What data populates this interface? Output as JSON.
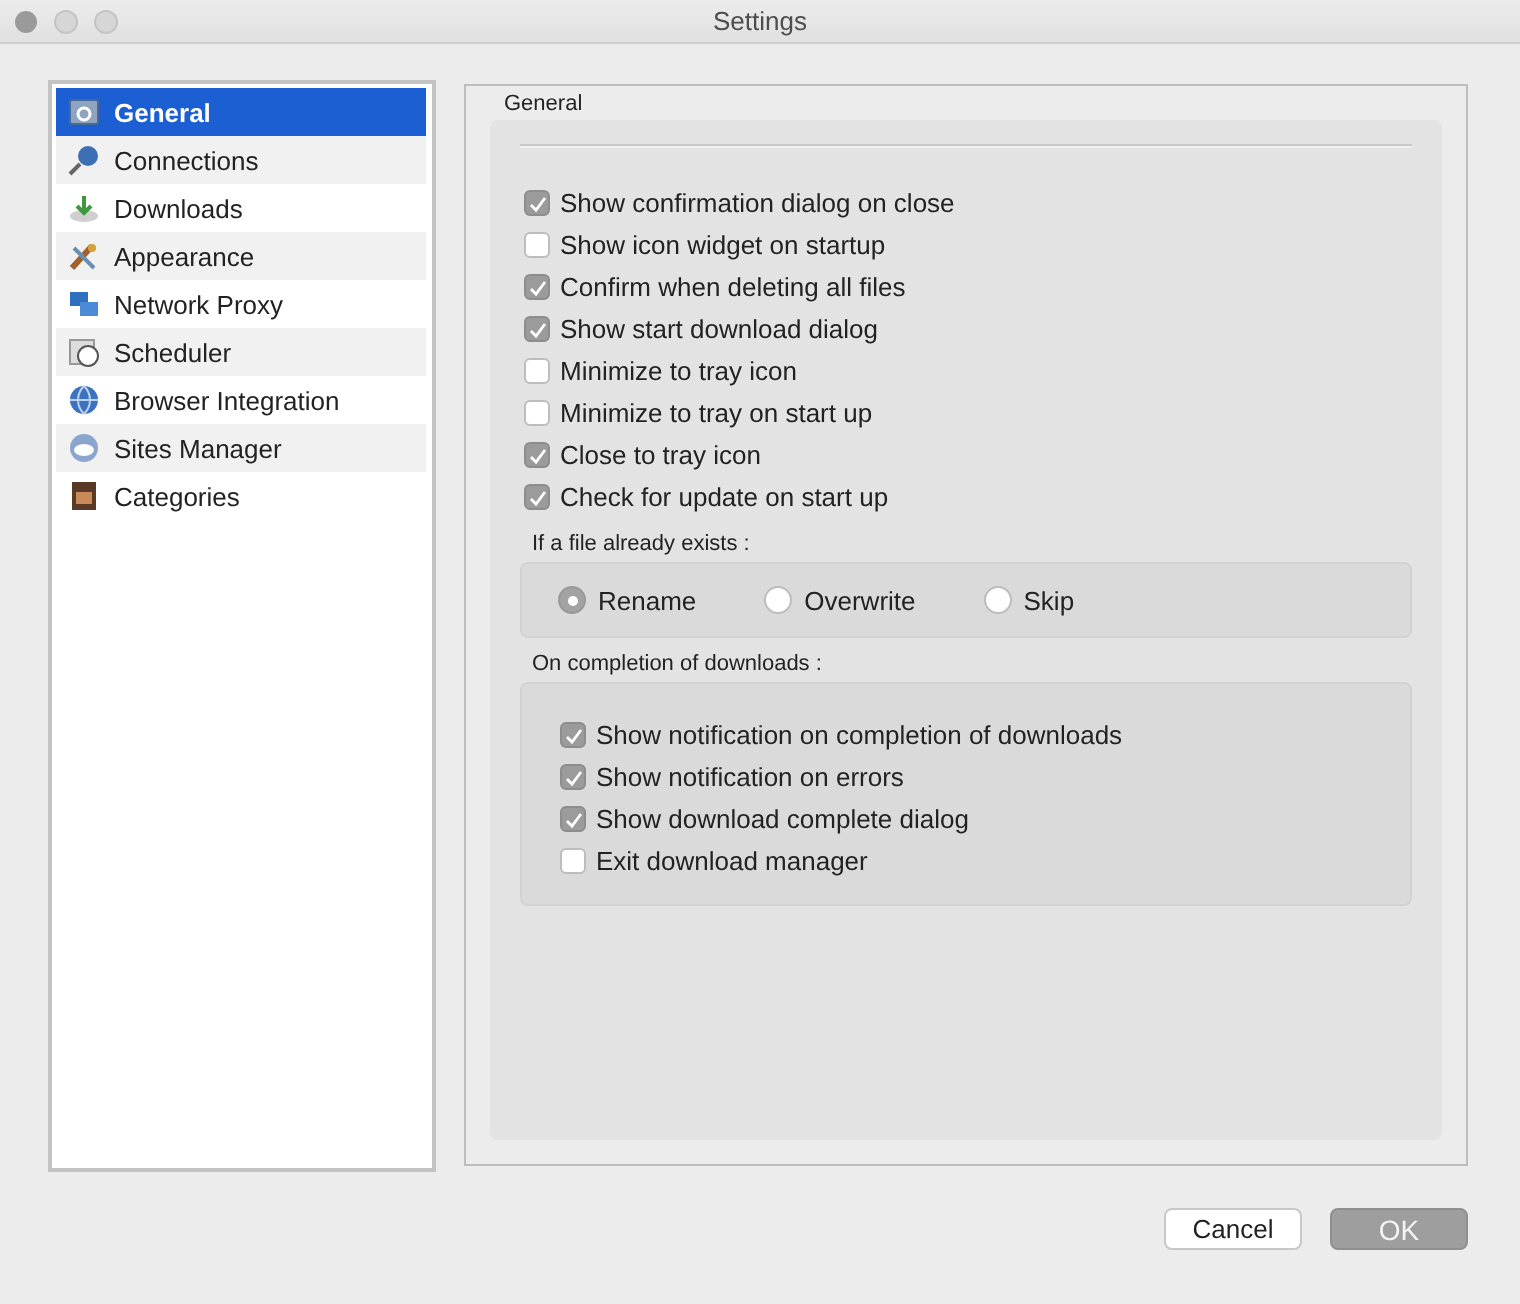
{
  "window": {
    "title": "Settings"
  },
  "sidebar": {
    "items": [
      {
        "label": "General",
        "selected": true
      },
      {
        "label": "Connections",
        "selected": false
      },
      {
        "label": "Downloads",
        "selected": false
      },
      {
        "label": "Appearance",
        "selected": false
      },
      {
        "label": "Network Proxy",
        "selected": false
      },
      {
        "label": "Scheduler",
        "selected": false
      },
      {
        "label": "Browser Integration",
        "selected": false
      },
      {
        "label": "Sites Manager",
        "selected": false
      },
      {
        "label": "Categories",
        "selected": false
      }
    ]
  },
  "panel": {
    "title": "General",
    "options": [
      {
        "label": "Show confirmation dialog on close",
        "checked": true
      },
      {
        "label": "Show icon widget on startup",
        "checked": false
      },
      {
        "label": "Confirm when deleting all files",
        "checked": true
      },
      {
        "label": "Show start download dialog",
        "checked": true
      },
      {
        "label": "Minimize to tray icon",
        "checked": false
      },
      {
        "label": "Minimize to tray on start up",
        "checked": false
      },
      {
        "label": "Close to tray icon",
        "checked": true
      },
      {
        "label": "Check for update on start up",
        "checked": true
      }
    ],
    "file_exists": {
      "label": "If a file already exists :",
      "choices": [
        {
          "label": "Rename",
          "selected": true
        },
        {
          "label": "Overwrite",
          "selected": false
        },
        {
          "label": "Skip",
          "selected": false
        }
      ]
    },
    "completion": {
      "label": "On completion of downloads :",
      "options": [
        {
          "label": "Show notification on completion of downloads",
          "checked": true
        },
        {
          "label": "Show notification on errors",
          "checked": true
        },
        {
          "label": "Show download complete dialog",
          "checked": true
        },
        {
          "label": "Exit download manager",
          "checked": false
        }
      ]
    }
  },
  "buttons": [
    {
      "label": "Cancel",
      "default": false
    },
    {
      "label": "OK",
      "default": true
    }
  ]
}
